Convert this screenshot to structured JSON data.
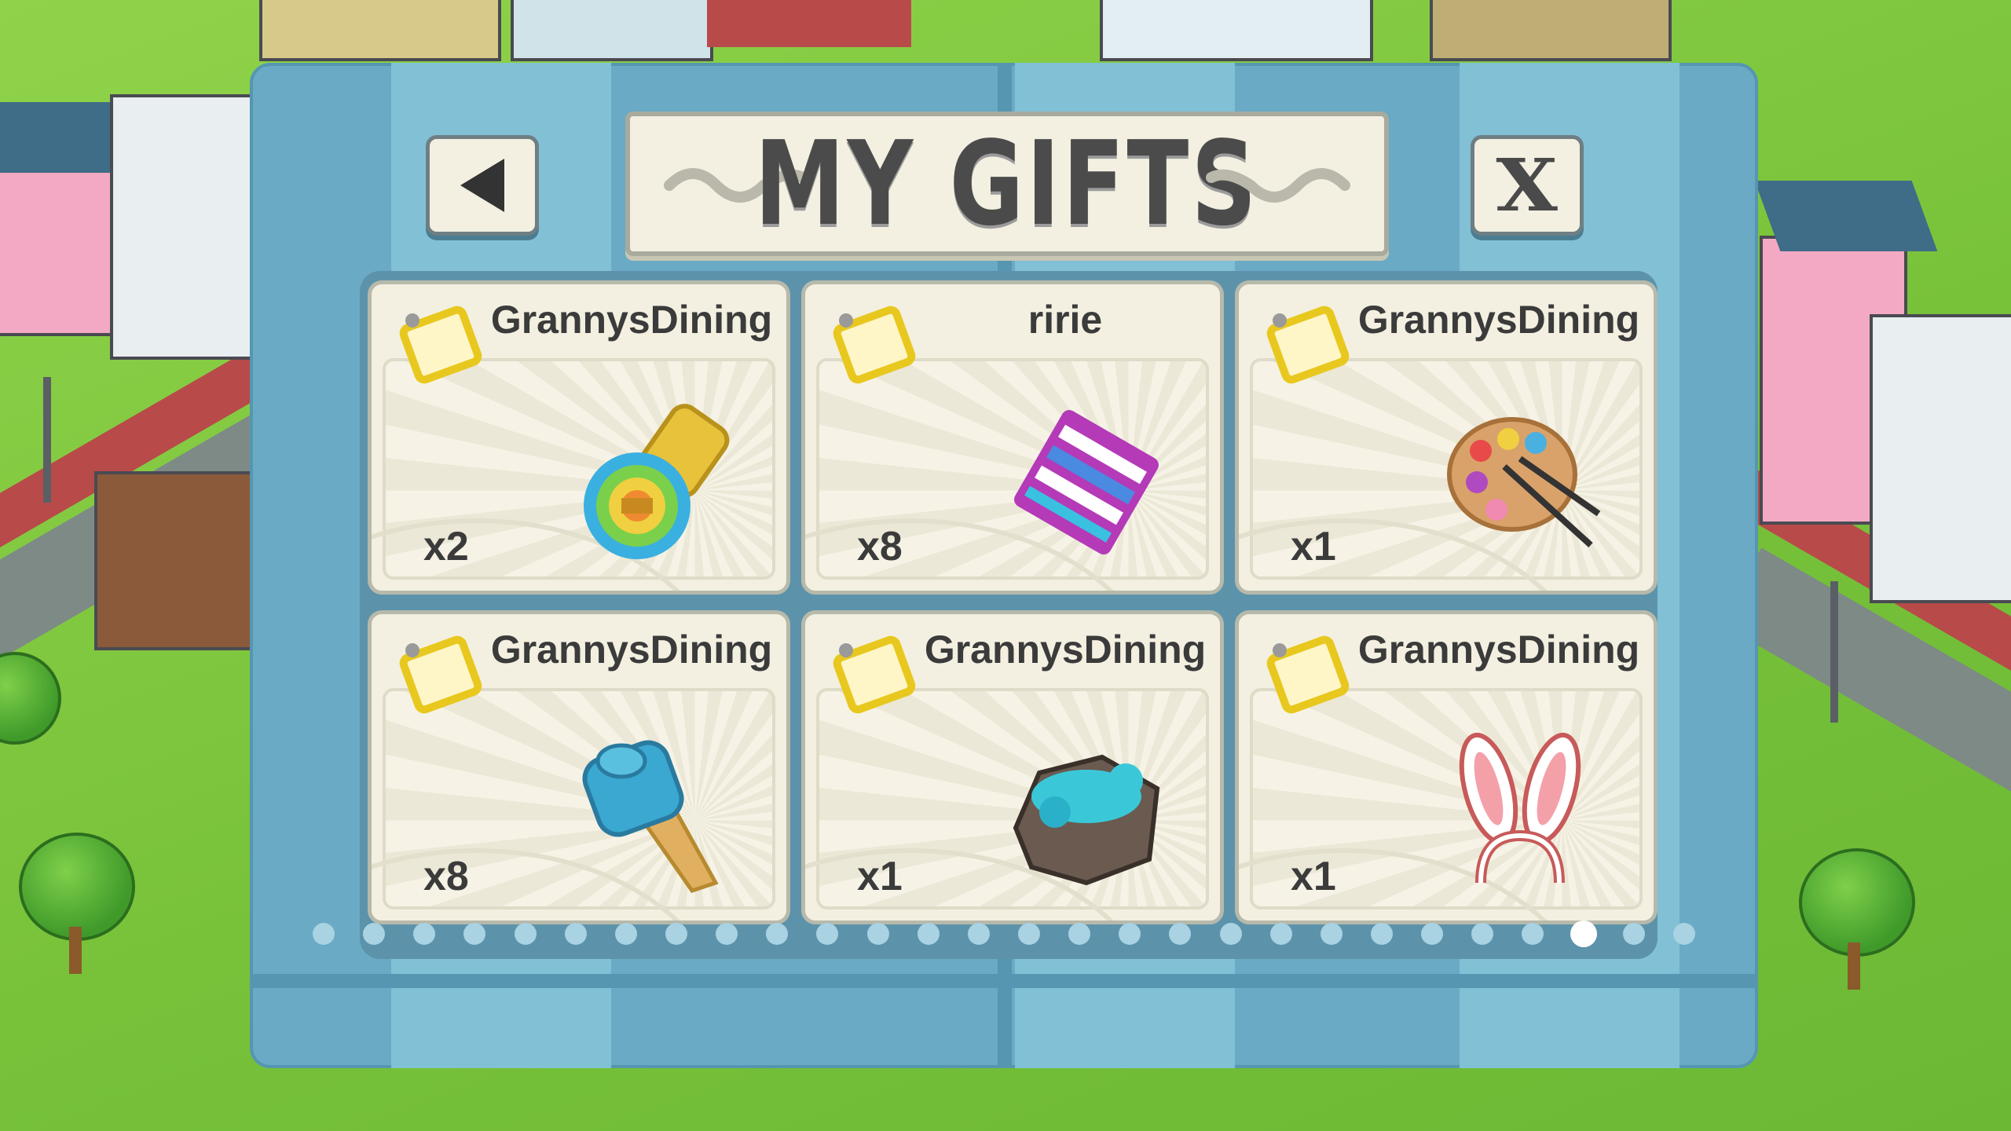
{
  "dialog": {
    "title": "MY GIFTS",
    "back_icon": "back-arrow-icon",
    "close_label": "X"
  },
  "gifts": [
    {
      "sender": "GrannysDining",
      "quantity": "x2",
      "item_icon": "rainbow-screw-icon"
    },
    {
      "sender": "ririe",
      "quantity": "x8",
      "item_icon": "striped-tile-icon"
    },
    {
      "sender": "GrannysDining",
      "quantity": "x1",
      "item_icon": "paint-palette-icon"
    },
    {
      "sender": "GrannysDining",
      "quantity": "x8",
      "item_icon": "blue-mallet-icon"
    },
    {
      "sender": "GrannysDining",
      "quantity": "x1",
      "item_icon": "ore-rock-icon"
    },
    {
      "sender": "GrannysDining",
      "quantity": "x1",
      "item_icon": "bunny-ears-icon"
    }
  ],
  "pagination": {
    "total_pages": 28,
    "current_page": 26
  },
  "colors": {
    "dialog_bg": "#6aaac4",
    "card_bg": "#f3f0e1",
    "text": "#3b3b3b",
    "grass": "#7cc43c"
  }
}
